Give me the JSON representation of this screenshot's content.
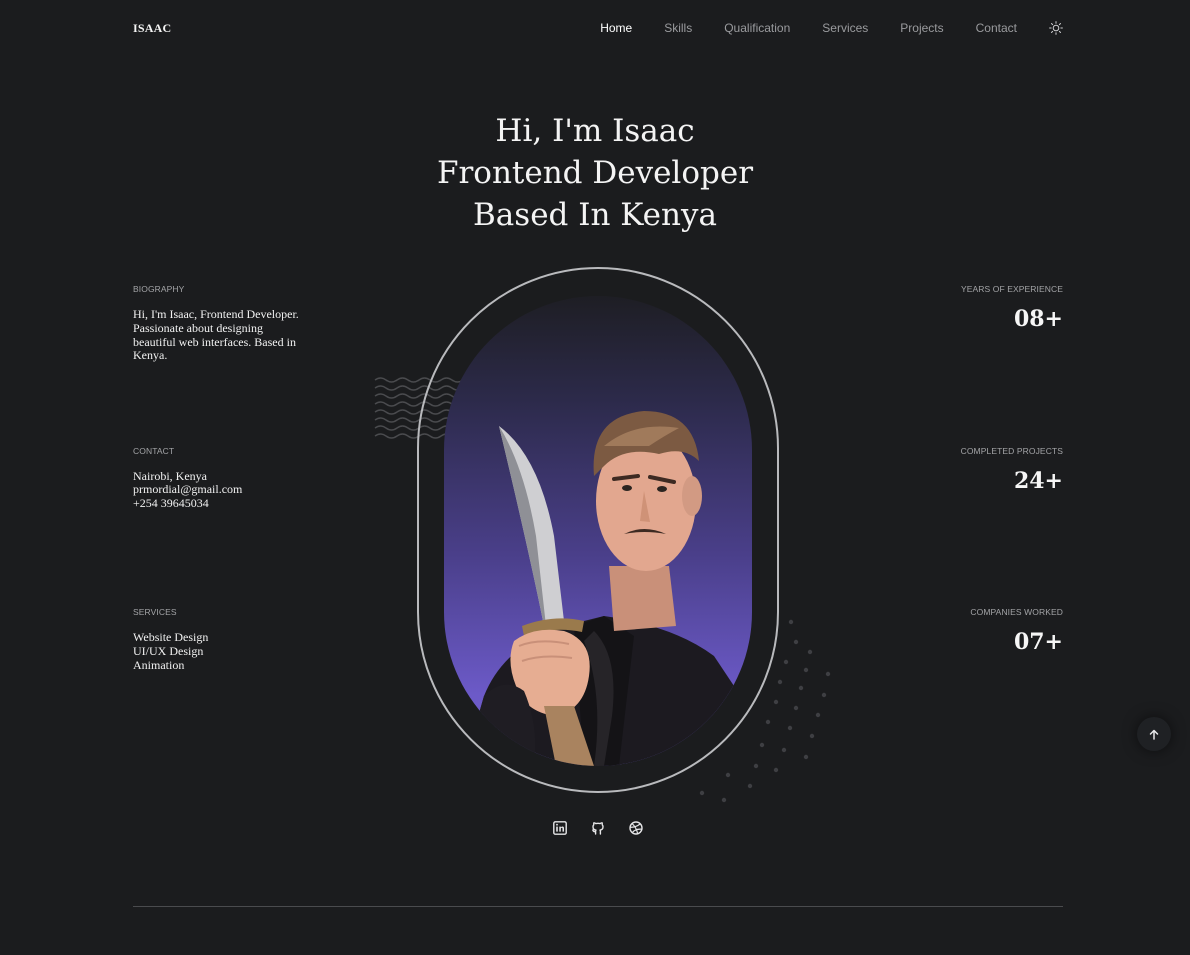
{
  "header": {
    "logo": "ISAAC",
    "nav": [
      "Home",
      "Skills",
      "Qualification",
      "Services",
      "Projects",
      "Contact"
    ],
    "active_nav": "Home",
    "theme_icon": "sun-icon"
  },
  "hero": {
    "line1": "Hi, I'm Isaac",
    "line2": "Frontend Developer",
    "line3": "Based In Kenya"
  },
  "left": {
    "biography": {
      "label": "BIOGRAPHY",
      "lines": [
        "Hi, I'm Isaac, Frontend Developer.",
        "Passionate about designing",
        "beautiful web interfaces. Based in",
        "Kenya."
      ]
    },
    "contact": {
      "label": "CONTACT",
      "lines": [
        "Nairobi, Kenya",
        "prmordial@gmail.com",
        "+254 39645034"
      ]
    },
    "services": {
      "label": "SERVICES",
      "lines": [
        "Website Design",
        "UI/UX Design",
        "Animation"
      ]
    }
  },
  "right": {
    "experience": {
      "label": "YEARS OF EXPERIENCE",
      "value": "08+"
    },
    "projects": {
      "label": "COMPLETED PROJECTS",
      "value": "24+"
    },
    "companies": {
      "label": "COMPANIES WORKED",
      "value": "07+"
    }
  },
  "socials": [
    "linkedin-icon",
    "github-icon",
    "dribbble-icon"
  ],
  "colors": {
    "background": "#1b1c1e",
    "portrait_gradient_top": "#2c2a4a",
    "portrait_gradient_bottom": "#7462d0",
    "text": "#f2f2f2",
    "muted": "#9a9b9e"
  }
}
